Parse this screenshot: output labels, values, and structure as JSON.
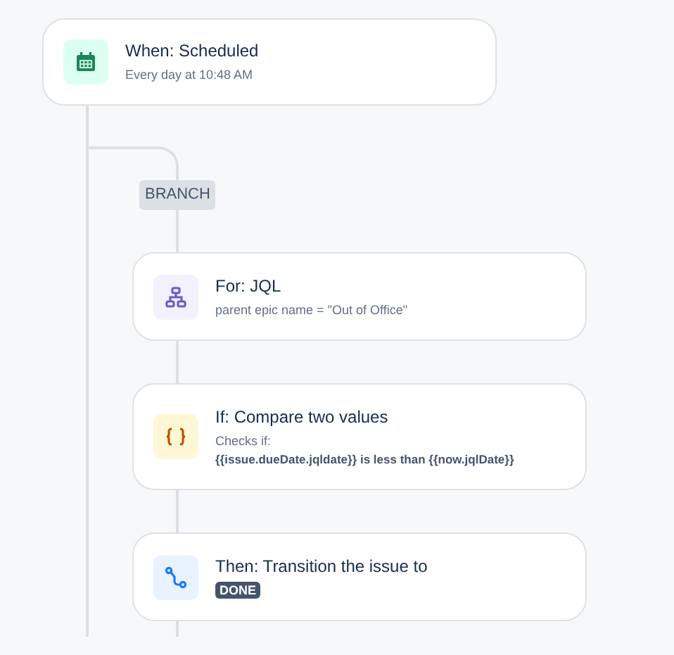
{
  "trigger": {
    "kind": "schedule",
    "title": "When: Scheduled",
    "subtitle": "Every day at 10:48 AM"
  },
  "branch": {
    "label": "BRANCH",
    "steps": [
      {
        "kind": "branch",
        "title": "For: JQL",
        "subtitle": "parent epic name = \"Out of Office\""
      },
      {
        "kind": "condition",
        "title": "If: Compare two values",
        "subtitle": "Checks if:",
        "expression": "{{issue.dueDate.jqldate}} is less than {{now.jqlDate}}"
      },
      {
        "kind": "action",
        "title": "Then: Transition the issue to",
        "status": "DONE"
      }
    ]
  }
}
